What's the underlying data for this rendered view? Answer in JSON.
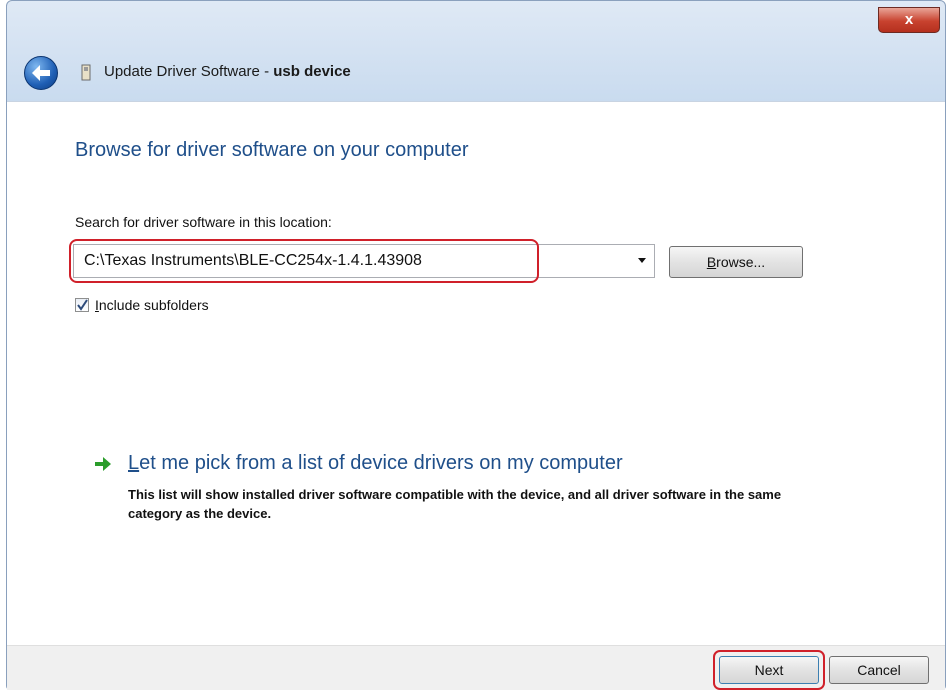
{
  "window": {
    "title_prefix": "Update Driver Software - ",
    "title_device": "usb device",
    "close_glyph": "x"
  },
  "page": {
    "heading": "Browse for driver software on your computer",
    "search_label": "Search for driver software in this location:",
    "path_value": "C:\\Texas Instruments\\BLE-CC254x-1.4.1.43908",
    "browse": {
      "accel": "B",
      "rest": "rowse..."
    },
    "include_subfolders": {
      "checked": true,
      "accel": "I",
      "rest": "nclude subfolders"
    },
    "pick_link": {
      "accel": "L",
      "rest": "et me pick from a list of device drivers on my computer"
    },
    "pick_description": "This list will show installed driver software compatible with the device, and all driver software in the same category as the device."
  },
  "footer": {
    "next_label": "Next",
    "cancel_label": "Cancel"
  },
  "colors": {
    "highlight": "#d0202a",
    "link_blue": "#1f4f8a",
    "pick_arrow_green": "#2a9d2a"
  },
  "icons": {
    "back": "back-arrow-icon",
    "device": "usb-device-icon",
    "dropdown": "chevron-down-icon",
    "check": "checkmark-icon",
    "pick": "green-arrow-icon"
  }
}
